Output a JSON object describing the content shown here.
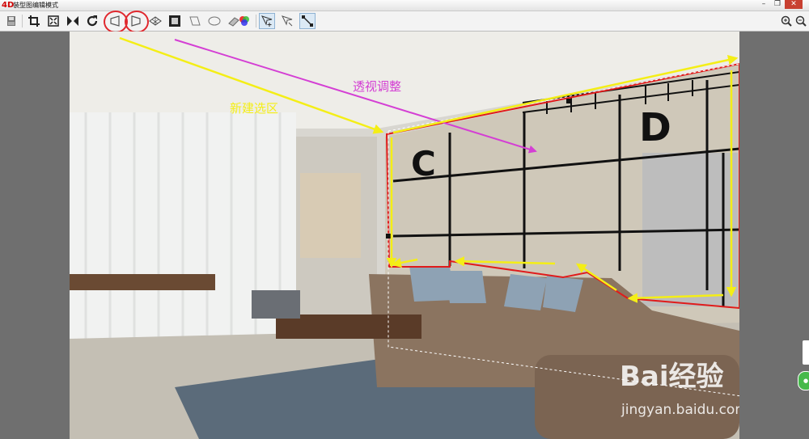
{
  "window": {
    "logo": "4D",
    "title": "装型图编辑模式",
    "minimize": "–",
    "restore": "❐",
    "close": "✕"
  },
  "toolbar": {
    "tools": [
      "save-icon",
      "crop-icon",
      "fit-frame-icon",
      "mirror-icon",
      "rotate-icon",
      "perspective-left-icon",
      "perspective-right-icon",
      "grid-plane-icon",
      "frame-fill-icon",
      "parallelogram-icon",
      "ellipse-icon",
      "eraser-icon",
      "color-wheel-icon",
      "add-region-icon",
      "edit-region-icon",
      "resize-arrow-icon",
      "zoom-in-icon",
      "zoom-out-icon"
    ]
  },
  "annotations": {
    "new_selection": "新建选区",
    "perspective_adjust": "透视调整",
    "wall_letter_c": "C",
    "wall_letter_d": "D"
  },
  "watermark": {
    "brand": "Bai经验",
    "url": "jingyan.baidu.com"
  },
  "colors": {
    "annotation_yellow": "#f4ee16",
    "annotation_magenta": "#d43fd4",
    "selection_red": "#e01b1b",
    "wall": "#cfc8b9",
    "sofa": "#8b7460"
  }
}
